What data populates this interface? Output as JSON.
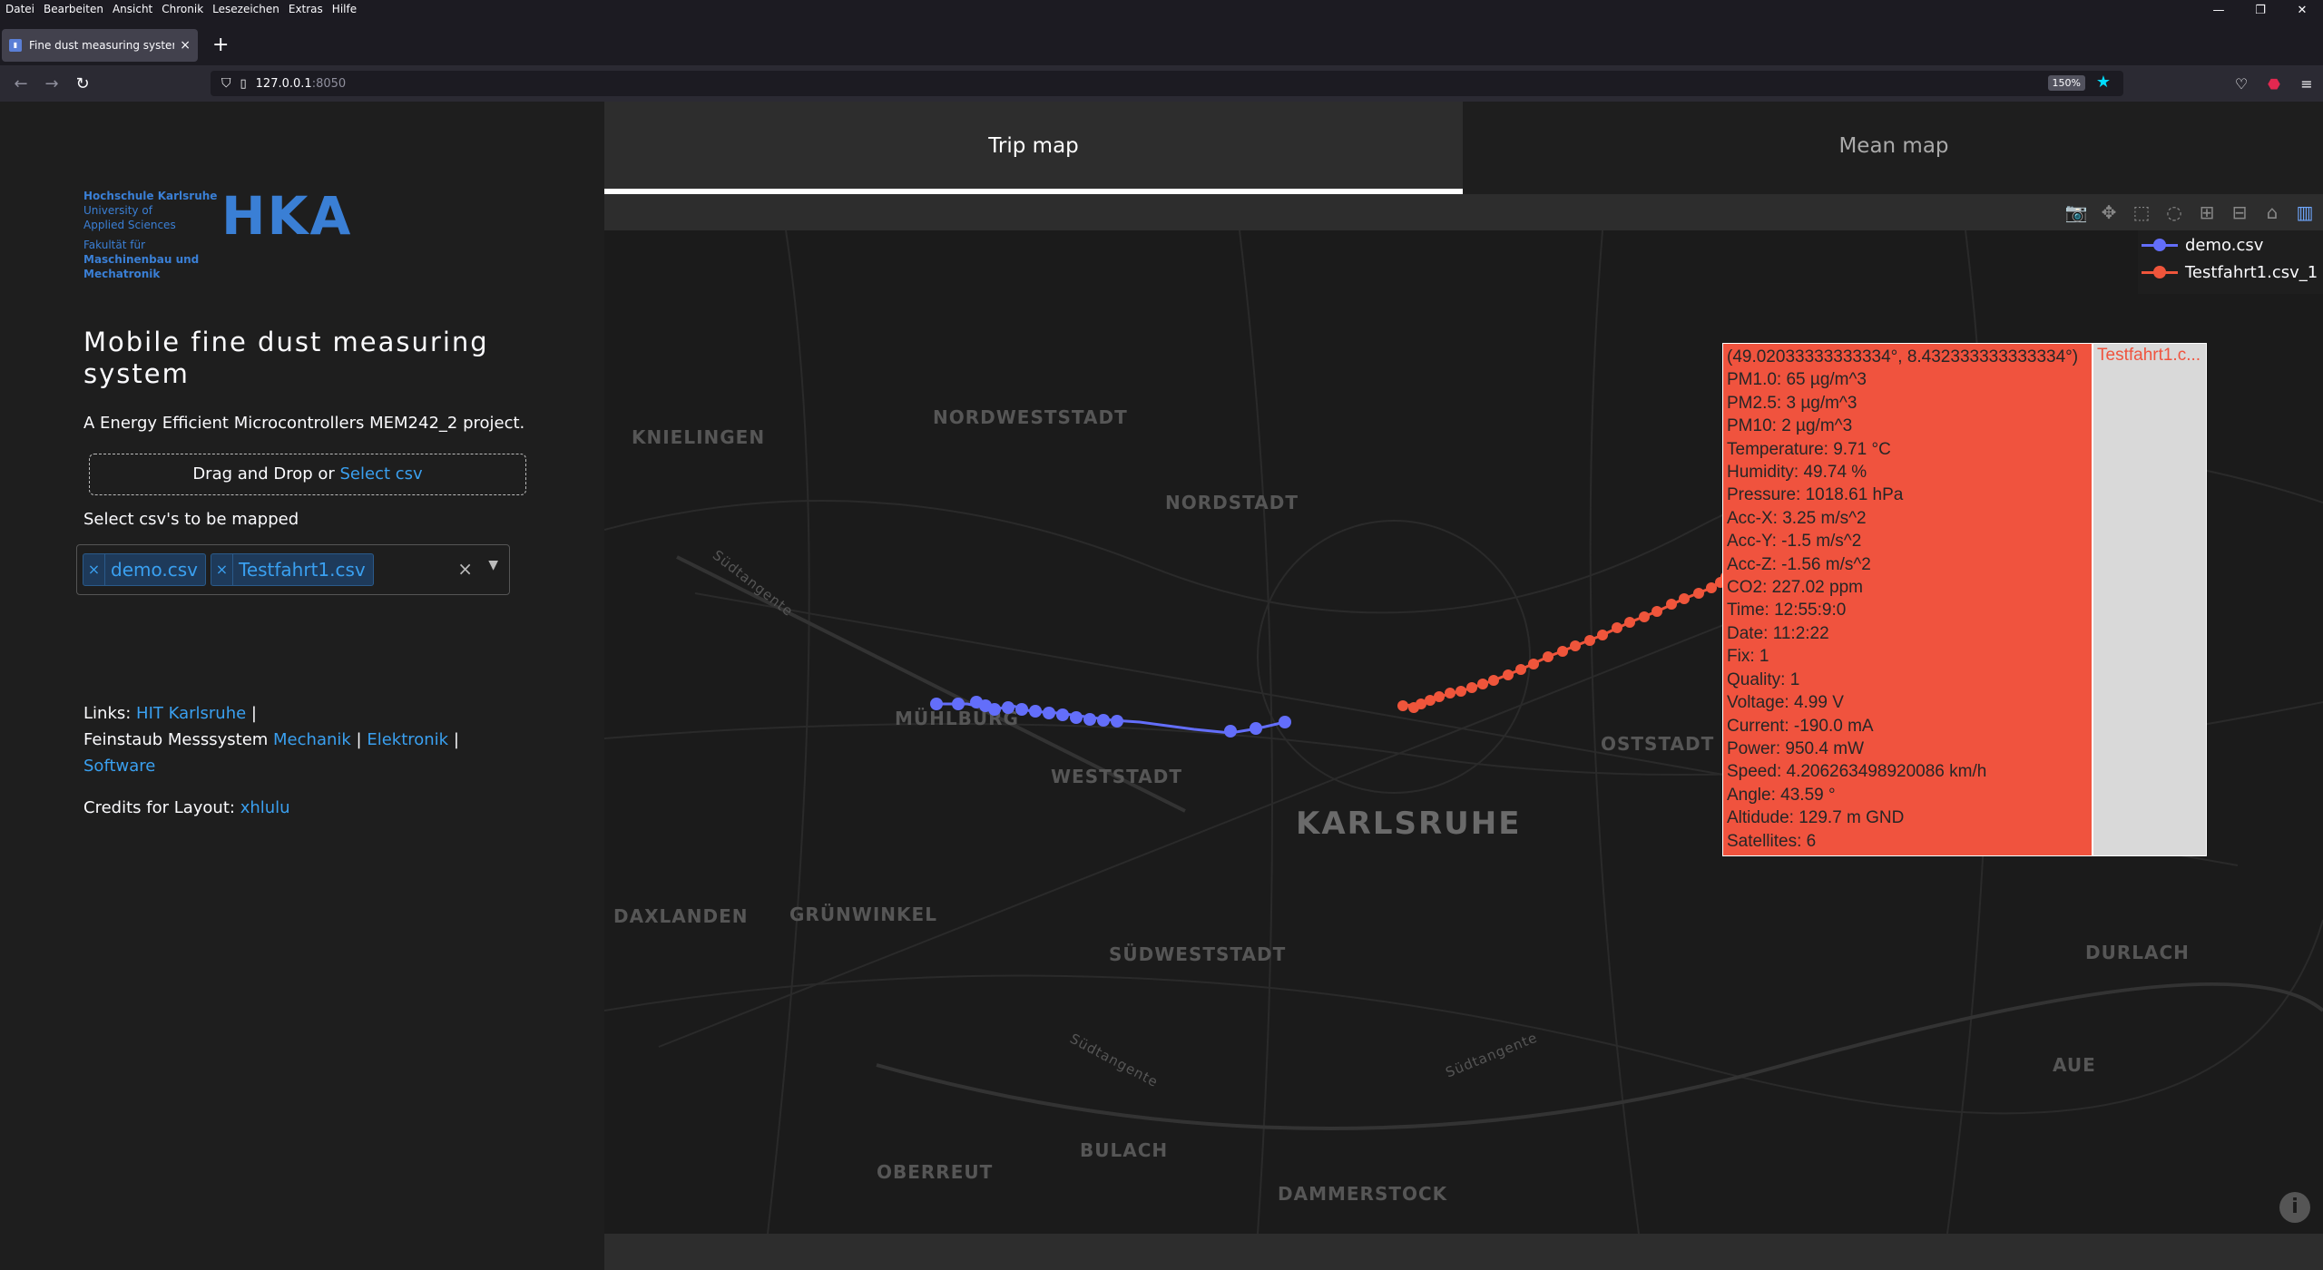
{
  "menu": [
    "Datei",
    "Bearbeiten",
    "Ansicht",
    "Chronik",
    "Lesezeichen",
    "Extras",
    "Hilfe"
  ],
  "browser": {
    "tab_title": "Fine dust measuring system mu",
    "url_host": "127.0.0.1",
    "url_port": ":8050",
    "zoom": "150%"
  },
  "sidebar": {
    "logo_lines": [
      "Hochschule Karlsruhe",
      "University of",
      "Applied Sciences",
      "Fakultät für",
      "Maschinenbau und",
      "Mechatronik"
    ],
    "logo_big": "HKA",
    "title": "Mobile fine dust measuring system",
    "description": "A Energy Efficient Microcontrollers MEM242_2 project.",
    "upload_text": "Drag and Drop or ",
    "upload_link": "Select csv",
    "select_label": "Select csv's to be mapped",
    "selected": [
      "demo.csv",
      "Testfahrt1.csv"
    ],
    "links_prefix": "Links: ",
    "link_hit": "HIT Karlsruhe",
    "sep": " | ",
    "fs_prefix": "Feinstaub Messsystem ",
    "link_mechanik": "Mechanik",
    "link_elektronik": "Elektronik",
    "link_software": "Software",
    "credits_prefix": "Credits for Layout: ",
    "credits_link": "xhlulu"
  },
  "main": {
    "tab_trip": "Trip map",
    "tab_mean": "Mean map"
  },
  "map": {
    "labels": [
      "KNIELINGEN",
      "NORDWESTSTADT",
      "NORDSTADT",
      "MÜHLBURG",
      "WESTSTADT",
      "KARLSRUHE",
      "OSTSTADT",
      "DAXLANDEN",
      "GRÜNWINKEL",
      "SÜDWESTSTADT",
      "DURLACH",
      "AUE",
      "BULACH",
      "OBERREUT",
      "DAMMERSTOCK",
      "Südtangente",
      "Südtangente",
      "Südtangente"
    ],
    "legend": [
      {
        "name": "demo.csv",
        "color": "#636efa"
      },
      {
        "name": "Testfahrt1.csv_1",
        "color": "#ef553b"
      }
    ],
    "hover": {
      "coord": "(49.02033333333334°, 8.432333333333334°)",
      "tag": "Testfahrt1.c...",
      "rows": [
        "PM1.0:   65 µg/m^3",
        "PM2.5:   3 µg/m^3",
        "PM10:   2 µg/m^3",
        "Temperature:   9.71 °C",
        "Humidity:   49.74 %",
        "Pressure:   1018.61 hPa",
        "Acc-X:   3.25 m/s^2",
        "Acc-Y:   -1.5 m/s^2",
        "Acc-Z:   -1.56 m/s^2",
        "CO2:   227.02 ppm",
        "Time:   12:55:9:0",
        "Date:   11:2:22",
        "Fix:   1",
        "Quality:   1",
        "Voltage:   4.99 V",
        "Current:   -190.0 mA",
        "Power:   950.4 mW",
        "Speed:   4.206263498920086 km/h",
        "Angle:   43.59 °",
        "Altidude:   129.7 m GND",
        "Satellites:   6"
      ]
    }
  }
}
